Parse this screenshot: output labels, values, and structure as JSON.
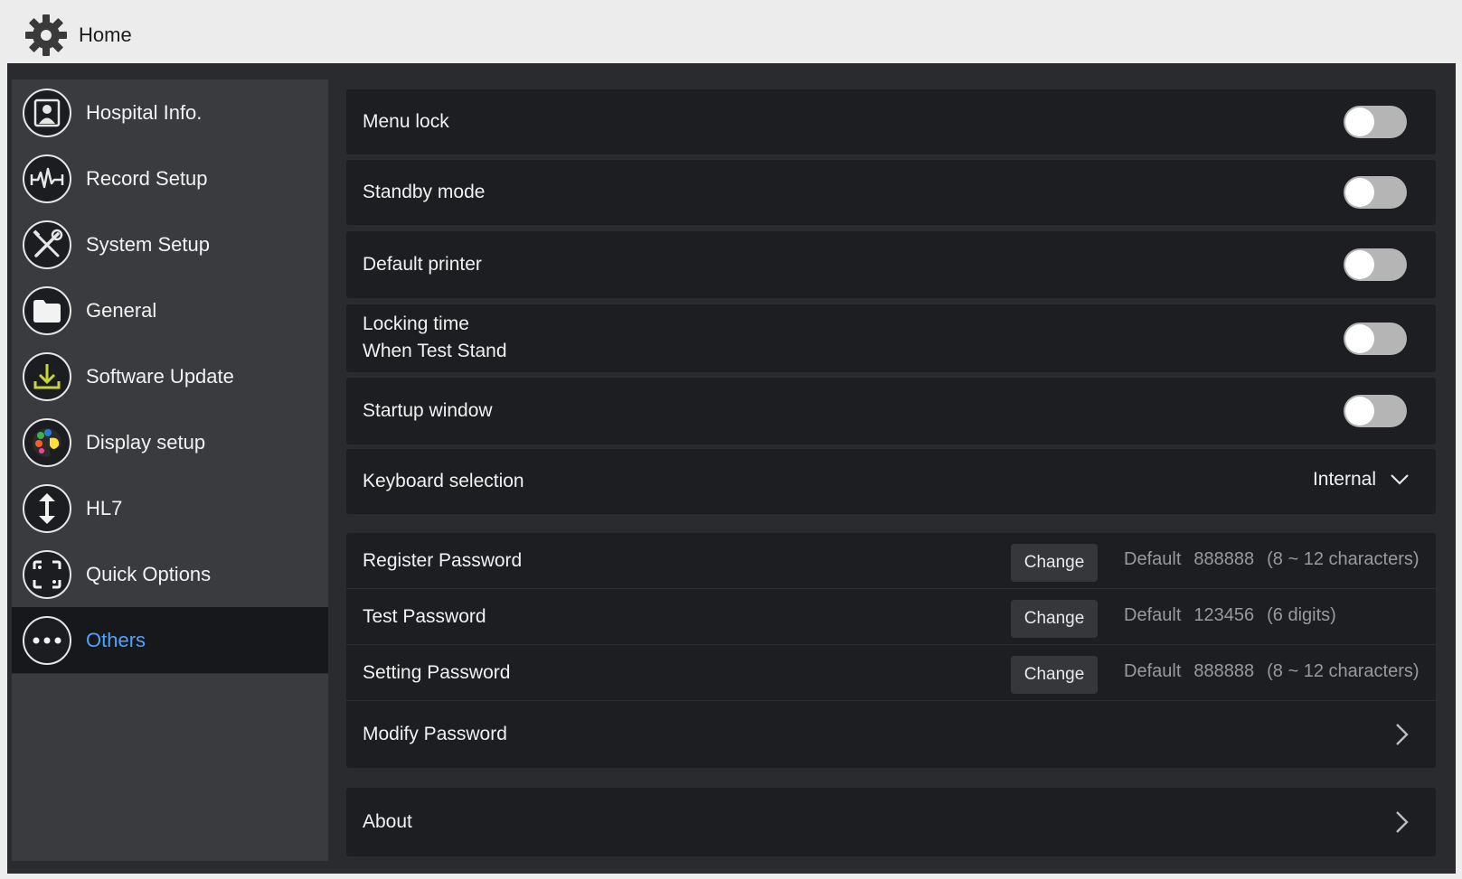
{
  "header": {
    "title": "Home",
    "icon": "gear-icon"
  },
  "sidebar": {
    "items": [
      {
        "label": "Hospital Info.",
        "icon": "hospital-info-icon"
      },
      {
        "label": "Record Setup",
        "icon": "ecg-waveform-icon"
      },
      {
        "label": "System Setup",
        "icon": "wrench-screwdriver-icon"
      },
      {
        "label": "General",
        "icon": "folder-icon"
      },
      {
        "label": "Software Update",
        "icon": "download-icon"
      },
      {
        "label": "Display setup",
        "icon": "palette-icon"
      },
      {
        "label": "HL7",
        "icon": "up-down-arrow-icon"
      },
      {
        "label": "Quick Options",
        "icon": "quick-options-icon"
      },
      {
        "label": "Others",
        "icon": "more-dots-icon",
        "active": true
      }
    ]
  },
  "settings": {
    "menu_lock": {
      "label": "Menu lock",
      "enabled": false
    },
    "standby_mode": {
      "label": "Standby mode",
      "enabled": false
    },
    "default_printer": {
      "label": "Default printer",
      "enabled": false
    },
    "locking_time": {
      "label_line1": "Locking time",
      "label_line2": "When Test Stand",
      "enabled": false
    },
    "startup_window": {
      "label": "Startup window",
      "enabled": false
    },
    "keyboard_selection": {
      "label": "Keyboard selection",
      "value": "Internal"
    }
  },
  "passwords": {
    "change_label": "Change",
    "default_label": "Default",
    "register": {
      "label": "Register Password",
      "default_value": "888888",
      "rule": "(8 ~ 12 characters)"
    },
    "test": {
      "label": "Test Password",
      "default_value": "123456",
      "rule": "(6 digits)"
    },
    "setting": {
      "label": "Setting Password",
      "default_value": "888888",
      "rule": "(8 ~ 12 characters)"
    },
    "modify": {
      "label": "Modify Password"
    }
  },
  "about": {
    "label": "About"
  },
  "colors": {
    "active_nav_text": "#4ea3ff",
    "background": "#2a2b2f",
    "row_background": "#1d1e21",
    "toggle_off": "#b5b5b5"
  }
}
